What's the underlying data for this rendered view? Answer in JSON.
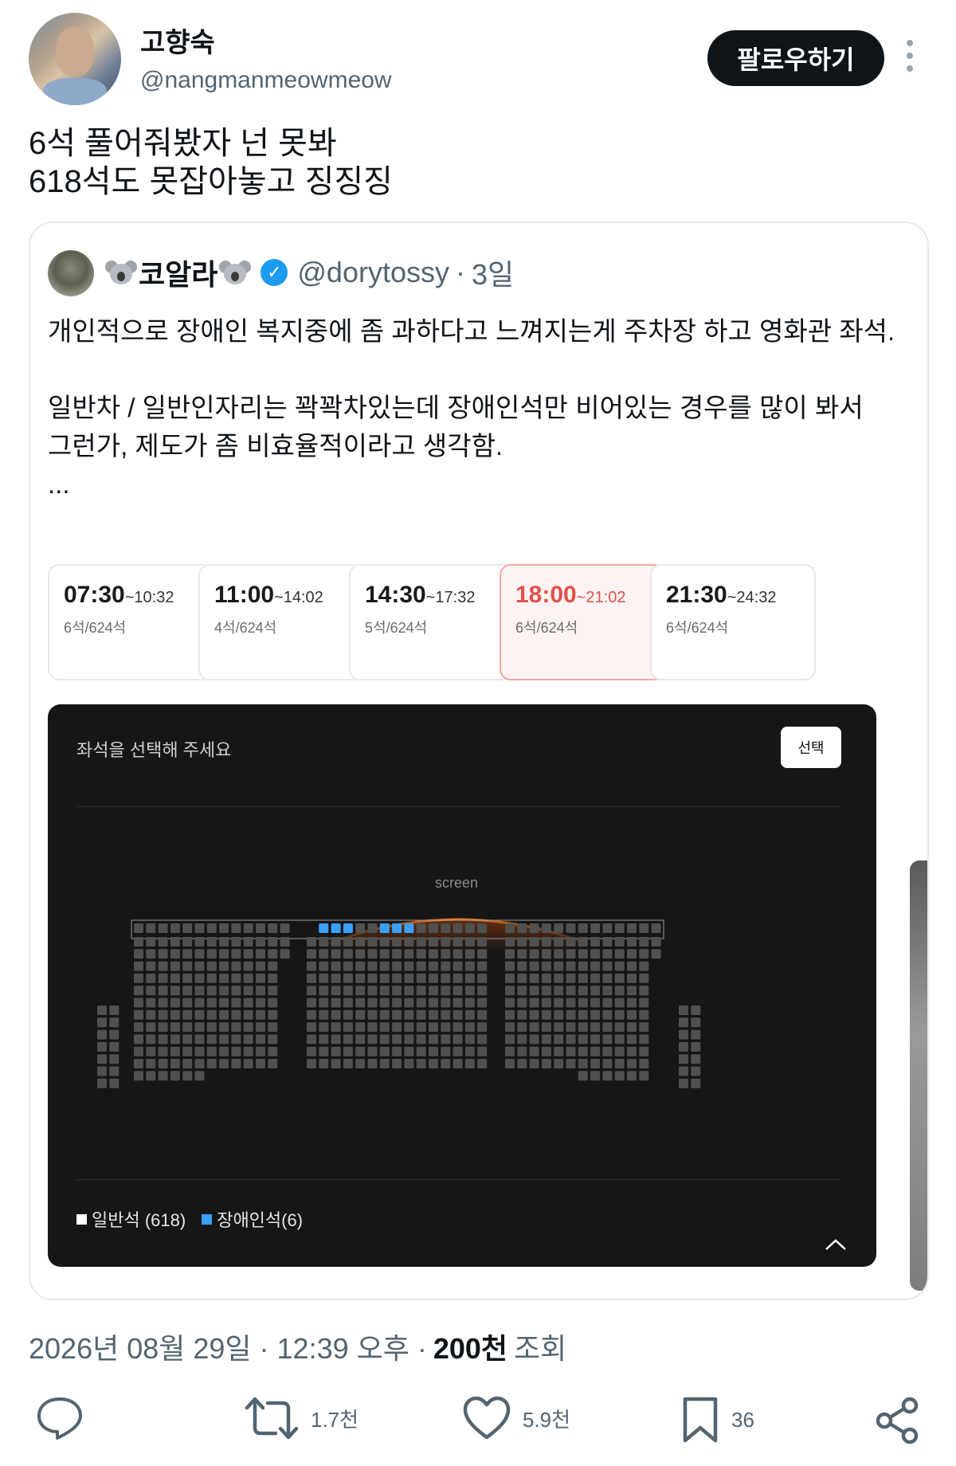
{
  "author": {
    "name": "고향숙",
    "handle": "@nangmanmeowmeow"
  },
  "follow_label": "팔로우하기",
  "tweet_lines": [
    "6석 풀어줘봤자 넌 못봐",
    "618석도 못잡아놓고 징징징"
  ],
  "quote": {
    "name": "코알라",
    "handle": "@dorytossy",
    "dot": "·",
    "time": "3일",
    "text": "개인적으로 장애인 복지중에 좀 과하다고 느껴지는게 주차장 하고 영화관 좌석.\n\n일반차 / 일반인자리는 꽉꽉차있는데 장애인석만 비어있는 경우를 많이 봐서\n그런가, 제도가 좀 비효율적이라고 생각함.\n...",
    "slots": [
      {
        "start": "07:30",
        "end": "~10:32",
        "seats": "6석/624석",
        "active": false
      },
      {
        "start": "11:00",
        "end": "~14:02",
        "seats": "4석/624석",
        "active": false
      },
      {
        "start": "14:30",
        "end": "~17:32",
        "seats": "5석/624석",
        "active": false
      },
      {
        "start": "18:00",
        "end": "~21:02",
        "seats": "6석/624석",
        "active": true
      },
      {
        "start": "21:30",
        "end": "~24:32",
        "seats": "6석/624석",
        "active": false
      }
    ],
    "seatmap": {
      "title": "좌석을 선택해 주세요",
      "select_label": "선택",
      "screen_label": "screen",
      "legend_regular": "일반석 (618)",
      "legend_disabled": "장애인석(6)",
      "regular_count": 618,
      "disabled_count": 6,
      "colors": {
        "regular": "#505050",
        "disabled": "#3aa0ff",
        "accent_slot": "#e0504a"
      }
    }
  },
  "meta": {
    "date": "2026년 08월 29일 · 12:39 오후 ·",
    "views": "200천",
    "views_label": "조회"
  },
  "actions": {
    "reply_icon": "comment-icon",
    "retweets": "1.7천",
    "likes": "5.9천",
    "bookmarks": "36",
    "share_icon": "share-icon"
  }
}
